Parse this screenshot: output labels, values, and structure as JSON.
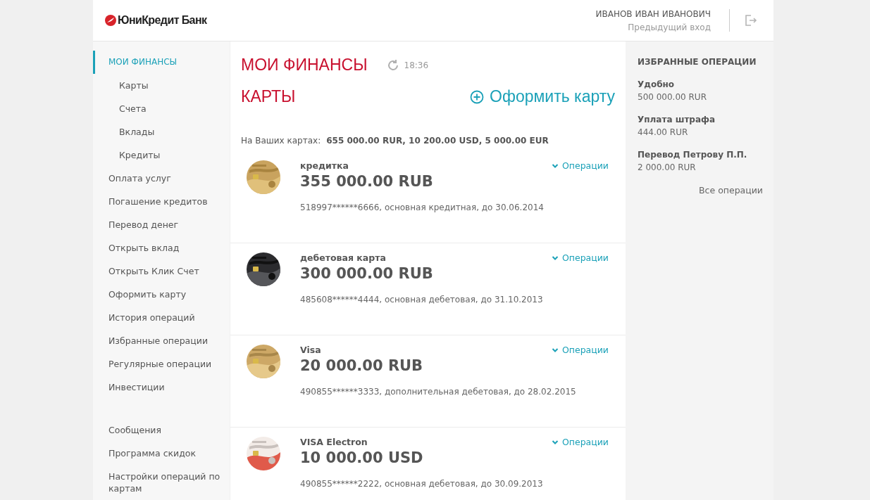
{
  "header": {
    "logo": "ЮниКредит Банк",
    "user_name": "ИВАНОВ ИВАН ИВАНОВИЧ",
    "previous_login": "Предыдущий вход"
  },
  "sidebar": {
    "items": [
      {
        "label": "МОИ ФИНАНСЫ",
        "selected": true,
        "children": [
          {
            "label": "Карты",
            "selected": false
          },
          {
            "label": "Счета",
            "selected": false
          },
          {
            "label": "Вклады",
            "selected": false
          },
          {
            "label": "Кредиты",
            "selected": false
          }
        ]
      },
      {
        "label": "Оплата услуг",
        "selected": false
      },
      {
        "label": "Погашение кредитов",
        "selected": false
      },
      {
        "label": "Перевод денег",
        "selected": false
      },
      {
        "label": "Открыть вклад",
        "selected": false
      },
      {
        "label": "Открыть Клик Счет",
        "selected": false
      },
      {
        "label": "Оформить карту",
        "selected": false
      },
      {
        "label": "История операций",
        "selected": false
      },
      {
        "label": "Избранные операции",
        "selected": false
      },
      {
        "label": "Регулярные операции",
        "selected": false
      },
      {
        "label": "Инвестиции",
        "selected": false
      }
    ],
    "secondary_items": [
      {
        "label": "Сообщения",
        "selected": false
      },
      {
        "label": "Программа скидок",
        "selected": false
      },
      {
        "label": "Настройки операций по картам",
        "selected": false
      }
    ]
  },
  "main": {
    "title": "МОИ ФИНАНСЫ",
    "time": "18:36",
    "section_title": "КАРТЫ",
    "new_card_button": "Оформить карту",
    "totals_label": "На Ваших картах:",
    "totals_value": "655 000.00 RUR, 10 200.00 USD, 5 000.00 EUR",
    "cards": [
      {
        "name": "кредитка",
        "balance": "355 000.00 RUB",
        "details": "518997******6666,  основная кредитная, до 30.06.2014",
        "operations": "Операции"
      },
      {
        "name": "дебетовая карта",
        "balance": "300 000.00 RUB",
        "details": "485608******4444,  основная дебетовая, до 31.10.2013",
        "operations": "Операции"
      },
      {
        "name": "Visa",
        "balance": "20 000.00 RUB",
        "details": "490855******3333,  дополнительная дебетовая, до 28.02.2015",
        "operations": "Операции"
      },
      {
        "name": "VISA Electron",
        "balance": "10 000.00 USD",
        "details": "490855******2222,  основная дебетовая, до 30.09.2013",
        "operations": "Операции"
      }
    ]
  },
  "favorites": {
    "title": "ИЗБРАННЫЕ ОПЕРАЦИИ",
    "items": [
      {
        "name": "Удобно",
        "amount": "500 000.00 RUR"
      },
      {
        "name": "Уплата штрафа",
        "amount": "444.00 RUR"
      },
      {
        "name": "Перевод Петрову П.П.",
        "amount": "2 000.00 RUR"
      }
    ],
    "all_link": "Все операции"
  }
}
